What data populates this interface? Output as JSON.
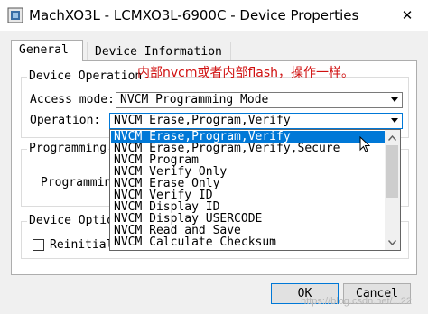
{
  "window": {
    "title": "MachXO3L - LCMXO3L-6900C - Device Properties",
    "close_glyph": "✕"
  },
  "tabs": [
    {
      "label": "General",
      "active": true
    },
    {
      "label": "Device Information",
      "active": false
    }
  ],
  "device_operation": {
    "legend": "Device Operation",
    "access_mode_label": "Access mode:",
    "access_mode_value": "NVCM Programming Mode",
    "operation_label": "Operation:",
    "operation_value": "NVCM Erase,Program,Verify"
  },
  "annotation": "内部nvcm或者内部flash，操作一样。",
  "dropdown_items": [
    {
      "label": "NVCM Erase,Program,Verify",
      "selected": true
    },
    {
      "label": "NVCM Erase,Program,Verify,Secure",
      "selected": false
    },
    {
      "label": "NVCM Program",
      "selected": false
    },
    {
      "label": "NVCM Verify Only",
      "selected": false
    },
    {
      "label": "NVCM Erase Only",
      "selected": false
    },
    {
      "label": "NVCM Verify ID",
      "selected": false
    },
    {
      "label": "NVCM Display ID",
      "selected": false
    },
    {
      "label": "NVCM Display USERCODE",
      "selected": false
    },
    {
      "label": "NVCM Read and Save",
      "selected": false
    },
    {
      "label": "NVCM Calculate Checksum",
      "selected": false
    }
  ],
  "programming_options": {
    "legend": "Programming",
    "file_label": "Programming"
  },
  "device_options": {
    "legend": "Device Optio",
    "checkbox_label": "Reinitial"
  },
  "buttons": {
    "ok": "OK",
    "cancel": "Cancel"
  },
  "watermark": "https://blog.csdn.net/...22",
  "colors": {
    "selection": "#0078d7",
    "annotation": "#d01010"
  }
}
